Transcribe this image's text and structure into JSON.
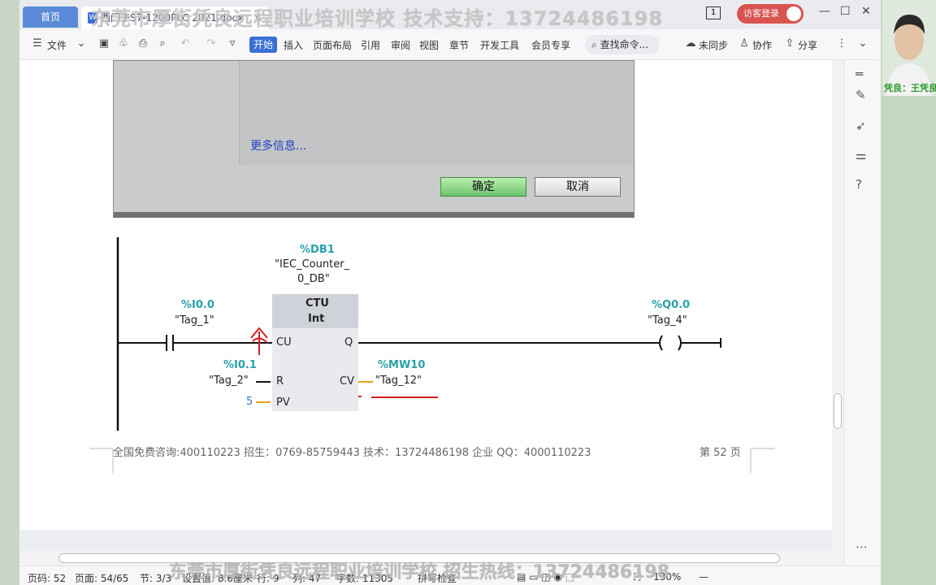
{
  "tabs": {
    "home": "首页",
    "doc": "西门子S7-1200PLC 2021.docx",
    "close": "×"
  },
  "watermark_top": "东莞市厚街凭良远程职业培训学校 技术支持：13724486198",
  "watermark_bottom": "东莞市厚街凭良远程职业培训学校 招生热线：13724486198",
  "titlebar": {
    "page_box": "1",
    "login": "访客登录"
  },
  "toolbar": {
    "file": "文件",
    "tabs": [
      "开始",
      "插入",
      "页面布局",
      "引用",
      "审阅",
      "视图",
      "章节",
      "开发工具",
      "会员专享"
    ],
    "search": "查找命令...",
    "sync": "未同步",
    "collab": "协作",
    "share": "分享"
  },
  "dialog": {
    "more_info": "更多信息...",
    "ok": "确定",
    "cancel": "取消"
  },
  "ladder": {
    "db_addr": "%DB1",
    "db_name_1": "\"IEC_Counter_",
    "db_name_2": "0_DB\"",
    "block_type": "CTU",
    "block_dtype": "Int",
    "pin_cu": "CU",
    "pin_q": "Q",
    "pin_r": "R",
    "pin_cv": "CV",
    "pin_pv": "PV",
    "contact1_addr": "%I0.0",
    "contact1_tag": "\"Tag_1\"",
    "reset_addr": "%I0.1",
    "reset_tag": "\"Tag_2\"",
    "pv_value": "5",
    "cv_addr": "%MW10",
    "cv_tag": "\"Tag_12\"",
    "coil_addr": "%Q0.0",
    "coil_tag": "\"Tag_4\""
  },
  "page_footer": {
    "text": "全国免费咨询:400110223    招生：0769-85759443    技术：13724486198    企业 QQ：4000110223",
    "page": "第  52  页"
  },
  "statusbar": {
    "pages": "页码: 52",
    "page_of": "页面: 54/65",
    "section": "节: 3/3",
    "setting": "设置值: 8.6厘米",
    "row": "行: 9",
    "col": "列: 47",
    "words": "字数: 11305",
    "spell": "拼写检查",
    "zoom": "130%"
  },
  "webcam": {
    "caption": "凭良：王凭良"
  },
  "colors": {
    "accent": "#3b6fd4",
    "annotation": "#d42020",
    "tag_address": "#2aa0a8",
    "ok_button": "#6cc36a"
  }
}
